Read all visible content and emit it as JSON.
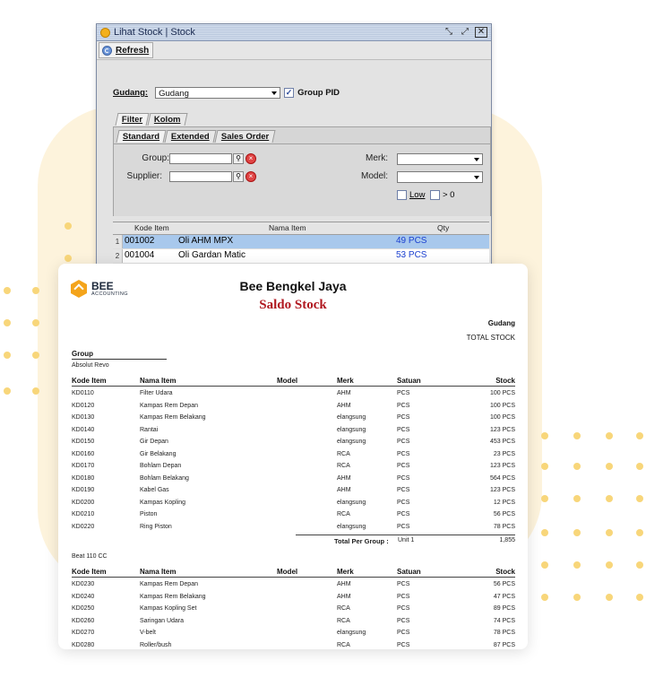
{
  "window": {
    "title": "Lihat Stock | Stock",
    "controls": [
      "restore-icon",
      "maximize-icon",
      "close-icon"
    ],
    "toolbar": {
      "refresh_label": "Refresh"
    },
    "gudang": {
      "label": "Gudang:",
      "value": "Gudang"
    },
    "group_pid": {
      "label": "Group PID",
      "checked": true
    },
    "tabs": [
      "Filter",
      "Kolom"
    ],
    "subtabs": [
      "Standard",
      "Extended",
      "Sales Order"
    ],
    "filters": {
      "group_label": "Group:",
      "supplier_label": "Supplier:",
      "merk_label": "Merk:",
      "model_label": "Model:",
      "low_label": "Low",
      "gt_label": "> 0"
    },
    "grid": {
      "columns": [
        "Kode Item",
        "Nama Item",
        "Qty"
      ],
      "rows": [
        {
          "idx": "1",
          "kode": "001002",
          "nama": "Oli AHM MPX",
          "qty": "49 PCS"
        },
        {
          "idx": "2",
          "kode": "001004",
          "nama": "Oli Gardan Matic",
          "qty": "53 PCS"
        }
      ]
    }
  },
  "report": {
    "logo": {
      "line1": "BEE",
      "line2": "ACCOUNTING"
    },
    "company": "Bee Bengkel Jaya",
    "title": "Saldo Stock",
    "gudang_label": "Gudang",
    "total_label": "TOTAL STOCK",
    "group_header": "Group",
    "columns": {
      "kode": "Kode Item",
      "nama": "Nama Item",
      "model": "Model",
      "merk": "Merk",
      "satuan": "Satuan",
      "stock": "Stock"
    },
    "groups": [
      {
        "name": "Absolut Revo",
        "rows": [
          {
            "kode": "KD0110",
            "nama": "Filter Udara",
            "model": "",
            "merk": "AHM",
            "satuan": "PCS",
            "stock": "100 PCS"
          },
          {
            "kode": "KD0120",
            "nama": "Kampas Rem Depan",
            "model": "",
            "merk": "AHM",
            "satuan": "PCS",
            "stock": "100 PCS"
          },
          {
            "kode": "KD0130",
            "nama": "Kampas Rem Belakang",
            "model": "",
            "merk": "elangsung",
            "satuan": "PCS",
            "stock": "100 PCS"
          },
          {
            "kode": "KD0140",
            "nama": "Rantai",
            "model": "",
            "merk": "elangsung",
            "satuan": "PCS",
            "stock": "123 PCS"
          },
          {
            "kode": "KD0150",
            "nama": "Gir Depan",
            "model": "",
            "merk": "elangsung",
            "satuan": "PCS",
            "stock": "453 PCS"
          },
          {
            "kode": "KD0160",
            "nama": "Gir Belakang",
            "model": "",
            "merk": "RCA",
            "satuan": "PCS",
            "stock": "23 PCS"
          },
          {
            "kode": "KD0170",
            "nama": "Bohlam Depan",
            "model": "",
            "merk": "RCA",
            "satuan": "PCS",
            "stock": "123 PCS"
          },
          {
            "kode": "KD0180",
            "nama": "Bohlam Belakang",
            "model": "",
            "merk": "AHM",
            "satuan": "PCS",
            "stock": "564 PCS"
          },
          {
            "kode": "KD0190",
            "nama": "Kabel Gas",
            "model": "",
            "merk": "AHM",
            "satuan": "PCS",
            "stock": "123 PCS"
          },
          {
            "kode": "KD0200",
            "nama": "Kampas Kopling",
            "model": "",
            "merk": "elangsung",
            "satuan": "PCS",
            "stock": "12 PCS"
          },
          {
            "kode": "KD0210",
            "nama": "Piston",
            "model": "",
            "merk": "RCA",
            "satuan": "PCS",
            "stock": "56 PCS"
          },
          {
            "kode": "KD0220",
            "nama": "Ring Piston",
            "model": "",
            "merk": "elangsung",
            "satuan": "PCS",
            "stock": "78 PCS"
          }
        ],
        "total_label": "Total Per Group :",
        "total_unit": "Unit 1",
        "total_value": "1,855"
      },
      {
        "name": "Beat 110 CC",
        "rows": [
          {
            "kode": "KD0230",
            "nama": "Kampas Rem Depan",
            "model": "",
            "merk": "AHM",
            "satuan": "PCS",
            "stock": "56 PCS"
          },
          {
            "kode": "KD0240",
            "nama": "Kampas Rem Belakang",
            "model": "",
            "merk": "AHM",
            "satuan": "PCS",
            "stock": "47 PCS"
          },
          {
            "kode": "KD0250",
            "nama": "Kampas Kopling Set",
            "model": "",
            "merk": "RCA",
            "satuan": "PCS",
            "stock": "89 PCS"
          },
          {
            "kode": "KD0260",
            "nama": "Saringan Udara",
            "model": "",
            "merk": "RCA",
            "satuan": "PCS",
            "stock": "74 PCS"
          },
          {
            "kode": "KD0270",
            "nama": "V-belt",
            "model": "",
            "merk": "elangsung",
            "satuan": "PCS",
            "stock": "78 PCS"
          },
          {
            "kode": "KD0280",
            "nama": "Roller/bush",
            "model": "",
            "merk": "RCA",
            "satuan": "PCS",
            "stock": "87 PCS"
          }
        ]
      }
    ]
  }
}
